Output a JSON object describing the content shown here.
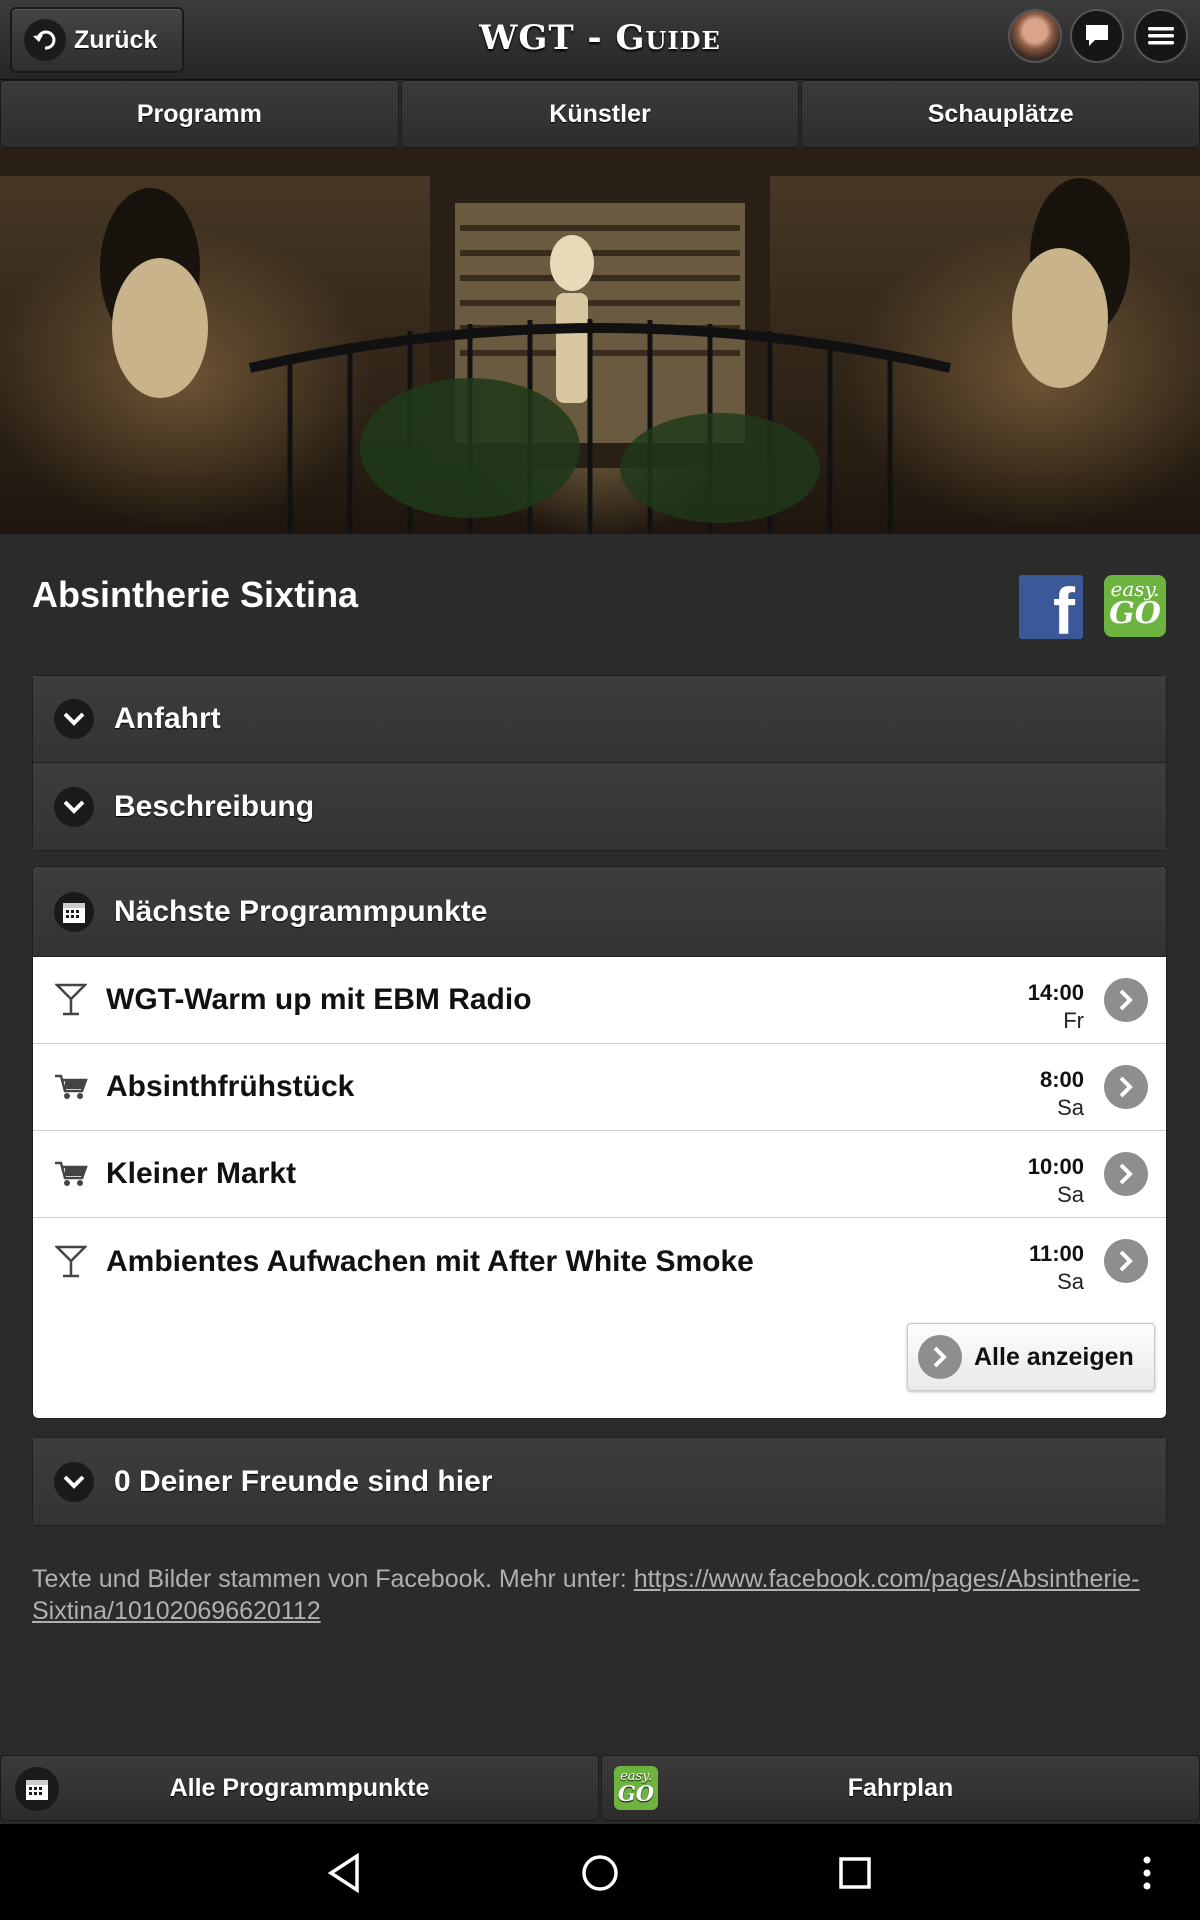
{
  "header": {
    "back_label": "Zurück",
    "app_title": "WGT - Guide"
  },
  "tabs": [
    {
      "label": "Programm"
    },
    {
      "label": "Künstler"
    },
    {
      "label": "Schauplätze"
    }
  ],
  "venue": {
    "name": "Absintherie Sixtina",
    "facebook_logo": "f",
    "easygo_logo_top": "easy.",
    "easygo_logo_bottom": "GO"
  },
  "sections": {
    "anfahrt": "Anfahrt",
    "beschreibung": "Beschreibung",
    "program_title": "Nächste Programmpunkte",
    "friends": "0 Deiner Freunde sind hier"
  },
  "program": [
    {
      "icon": "cocktail-icon",
      "title": "WGT-Warm up mit EBM Radio",
      "time": "14:00",
      "day": "Fr"
    },
    {
      "icon": "cart-icon",
      "title": "Absinthfrühstück",
      "time": "8:00",
      "day": "Sa"
    },
    {
      "icon": "cart-icon",
      "title": "Kleiner Markt",
      "time": "10:00",
      "day": "Sa"
    },
    {
      "icon": "cocktail-icon",
      "title": "Ambientes Aufwachen mit After White Smoke",
      "time": "11:00",
      "day": "Sa"
    }
  ],
  "show_all_label": "Alle anzeigen",
  "footer_note": {
    "text": "Texte und Bilder stammen von Facebook. Mehr unter: ",
    "link": "https://www.facebook.com/pages/Absintherie-Sixtina/101020696620112"
  },
  "bottom_bar": {
    "all_program": "Alle Programmpunkte",
    "timetable": "Fahrplan"
  },
  "colors": {
    "background": "#2b2b2b",
    "facebook": "#3b5998",
    "easygo": "#6db33f"
  }
}
